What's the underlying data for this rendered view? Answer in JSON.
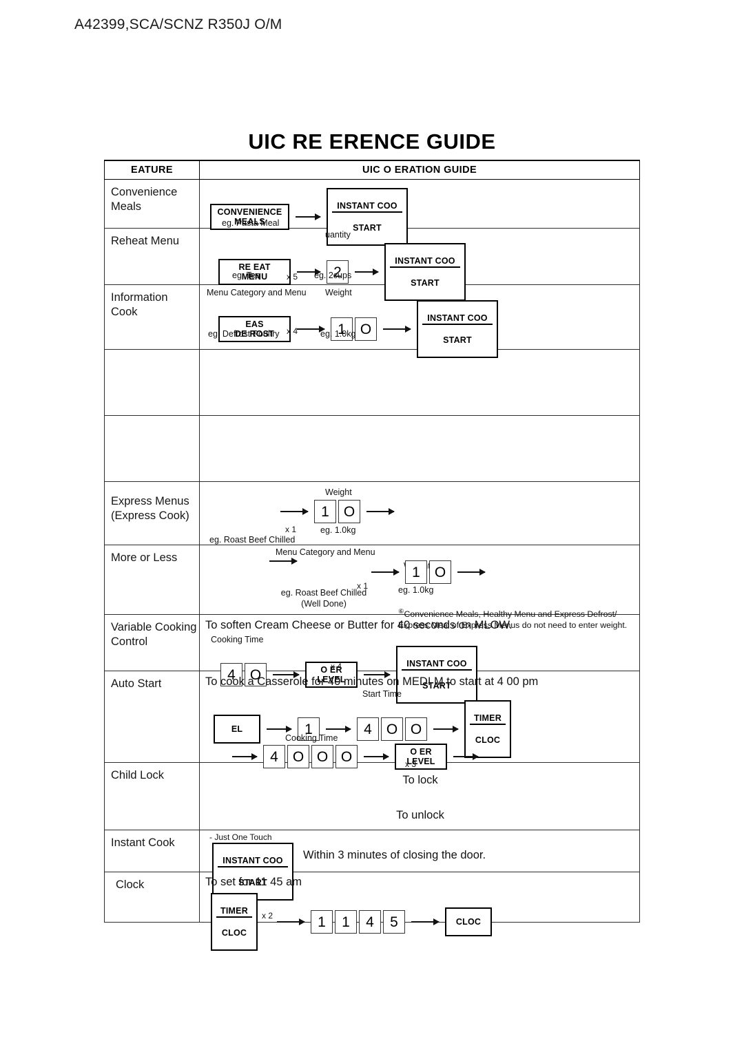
{
  "page": {
    "header": "A42399,SCA/SCNZ R350J O/M",
    "title": "UIC   RE ERENCE GUIDE"
  },
  "table": {
    "headers": {
      "feature": "EATURE",
      "guide": "UIC   O ERATION GUIDE"
    },
    "rows": [
      {
        "feature": "Convenience\nMeals",
        "buttons": {
          "primary": "CONVENIENCE\nMEALS",
          "start_top": "INSTANT COO",
          "start_bottom": "START"
        },
        "captions": {
          "example": "eg. Pasta Meal"
        }
      },
      {
        "feature": "Reheat Menu",
        "buttons": {
          "primary": "RE EAT\nMENU",
          "start_top": "INSTANT COO",
          "start_bottom": "START"
        },
        "digits": [
          "2"
        ],
        "captions": {
          "example": "eg. Tea",
          "multiplier": "x 5",
          "field_label": "uantity",
          "value_example": "eg. 2cups"
        }
      },
      {
        "feature": "Information\nCook",
        "buttons": {
          "primary": "EAS\nDE ROST",
          "start_top": "INSTANT COO",
          "start_bottom": "START"
        },
        "digits": [
          "1",
          "O"
        ],
        "captions": {
          "menu_label": "Menu Category and Menu",
          "weight_label": "Weight",
          "example": "eg. Defrost Poultry",
          "multiplier": "x 4",
          "value_example": "eg. 1.0kg"
        }
      },
      {
        "feature": "",
        "empty": true
      },
      {
        "feature": "",
        "empty": true
      },
      {
        "feature": "Express Menus\n(Express Cook)",
        "digits": [
          "1",
          "O"
        ],
        "captions": {
          "weight_label": "Weight",
          "example": "eg. Roast Beef Chilled",
          "multiplier": "x 1",
          "value_example": "eg. 1.0kg"
        }
      },
      {
        "feature": "More or Less",
        "digits": [
          "1",
          "O"
        ],
        "captions": {
          "menu_label": "Menu Category and Menu",
          "weight_label": "Weight",
          "weight_marker": "⑥",
          "example": "eg. Roast Beef Chilled\n(Well Done)",
          "multiplier": "x 1",
          "value_example": "eg. 1.0kg"
        },
        "footnote": {
          "marker": "⑥",
          "text": "Convenience Meals, Healthy Menu and Express Defrost/\nExpress Meal of Express Menus do not need to enter weight."
        }
      },
      {
        "feature": "Variable Cooking\nControl",
        "sentence": "To soften Cream Cheese or Butter for 40 seconds on MLOW.",
        "digits": [
          "4",
          "O"
        ],
        "buttons": {
          "power": "O   ER\nLEVEL",
          "start_top": "INSTANT COO",
          "start_bottom": "START"
        },
        "captions": {
          "time_label": "Cooking Time",
          "multiplier": "x 4"
        }
      },
      {
        "feature": "Auto Start",
        "sentence": "To cook a Casserole for 40 minutes on MEDI M to start at 4 00 pm",
        "buttons": {
          "del": "EL",
          "timer_top": "TIMER",
          "timer_bottom": "CLOC",
          "power": "O   ER\nLEVEL"
        },
        "digits_program": [
          "1"
        ],
        "digits_start_time": [
          "4",
          "O",
          "O"
        ],
        "digits_cooking_time": [
          "4",
          "O",
          "O",
          "O"
        ],
        "captions": {
          "start_time_label": "Start Time",
          "cooking_time_label": "Cooking Time",
          "multiplier": "x 3"
        }
      },
      {
        "feature": "Child Lock",
        "lines": [
          "To lock",
          "To unlock"
        ]
      },
      {
        "feature": "Instant Cook",
        "buttons": {
          "start_top": "INSTANT COO",
          "start_bottom": "START"
        },
        "captions": {
          "touch": "- Just One Touch"
        },
        "sentence": "Within 3 minutes of closing the door."
      },
      {
        "feature": "Clock",
        "sentence": "To set for 11 45 am",
        "buttons": {
          "timer_top": "TIMER",
          "timer_bottom": "CLOC",
          "clock": "CLOC"
        },
        "digits": [
          "1",
          "1",
          "4",
          "5"
        ],
        "captions": {
          "multiplier": "x 2"
        }
      }
    ]
  }
}
